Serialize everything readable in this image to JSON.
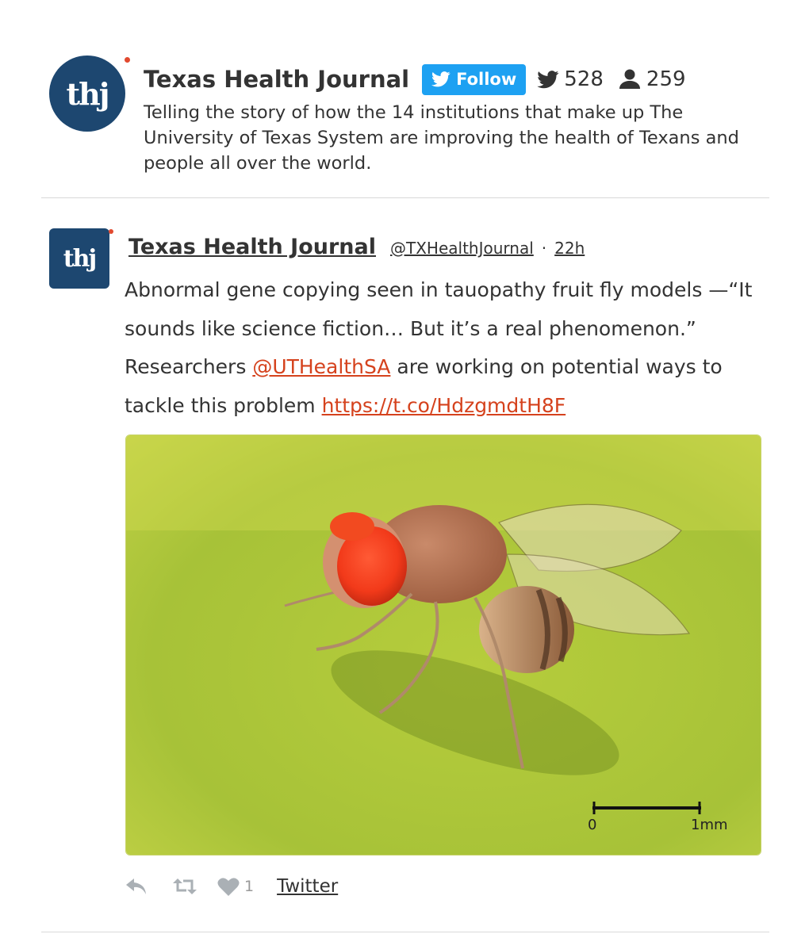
{
  "profile": {
    "logo_text": "thj",
    "name": "Texas Health Journal",
    "follow_label": "Follow",
    "tweets_count": "528",
    "followers_count": "259",
    "description": "Telling the story of how the 14 institutions that make up The University of Texas System are improving the health of Texans and people all over the world."
  },
  "tweet": {
    "logo_text": "thj",
    "author_name": "Texas Health Journal",
    "handle": "@TXHealthJournal",
    "separator": "·",
    "time": "22h",
    "text_part1": "Abnormal gene copying seen in tauopathy fruit fly models —“It sounds like science fiction… But it’s a real phenomenon.” Researchers ",
    "mention": "@UTHealthSA",
    "text_part2": " are working on potential ways to tackle this problem ",
    "link": "https://t.co/HdzgmdtH8F",
    "image": {
      "scale_start": "0",
      "scale_end": "1mm"
    },
    "actions": {
      "like_count": "1",
      "source_label": "Twitter"
    }
  },
  "colors": {
    "brand_navy": "#1d4770",
    "logo_dot": "#e1492f",
    "follow_blue": "#1da1f2",
    "link_red": "#d5421d",
    "action_gray": "#aab0b5"
  },
  "icons": {
    "follow": "twitter-bird-icon",
    "tweets": "twitter-bird-icon",
    "followers": "person-icon",
    "reply": "reply-icon",
    "retweet": "retweet-icon",
    "like": "heart-icon"
  }
}
